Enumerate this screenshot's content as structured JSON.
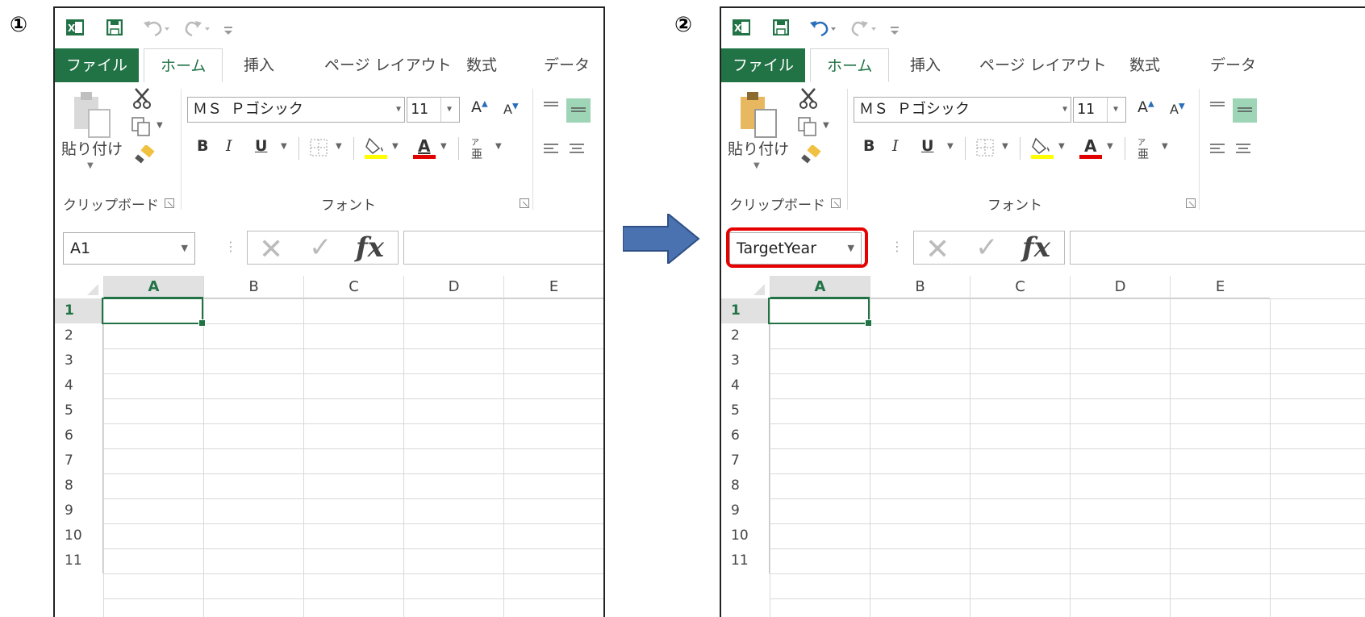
{
  "step_labels": [
    "①",
    "②"
  ],
  "colors": {
    "excel_green": "#217346",
    "arrow_blue": "#4a72b0",
    "highlight_red": "#e60000",
    "font_color_red": "#e00000",
    "highlight_yellow": "#ffff00"
  },
  "excel": {
    "tabs": [
      "ファイル",
      "ホーム",
      "挿入",
      "ページ レイアウト",
      "数式",
      "データ"
    ],
    "clipboard": {
      "paste_label": "貼り付け",
      "group_label": "クリップボード"
    },
    "font": {
      "name": "ＭＳ Ｐゴシック",
      "size": "11",
      "group_label": "フォント",
      "bold": "B",
      "italic": "I",
      "underline": "U",
      "grow": "A",
      "shrink": "A"
    },
    "formula_bar": {
      "fx": "fx",
      "cancel": "✕",
      "enter": "✓"
    },
    "columns": [
      "A",
      "B",
      "C",
      "D",
      "E"
    ],
    "rows": [
      "1",
      "2",
      "3",
      "4",
      "5",
      "6",
      "7",
      "8",
      "9",
      "10",
      "11"
    ]
  },
  "panel_before": {
    "namebox_value": "A1"
  },
  "panel_after": {
    "namebox_value": "TargetYear"
  },
  "icons": [
    "excel-logo-icon",
    "save-icon",
    "undo-icon",
    "redo-icon",
    "customize-qat-icon",
    "paste-icon",
    "cut-icon",
    "copy-icon",
    "format-painter-icon",
    "border-icon",
    "fill-color-icon",
    "font-color-icon",
    "phonetic-icon",
    "align-icon",
    "dialog-launcher-icon",
    "arrow-right-icon"
  ]
}
